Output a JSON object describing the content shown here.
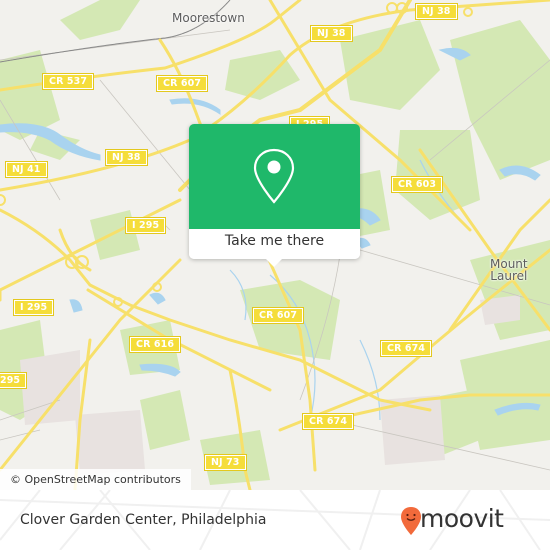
{
  "map": {
    "places": [
      {
        "id": "moorestown",
        "label": "Moorestown"
      },
      {
        "id": "mount-laurel",
        "label": "Mount\nLaurel"
      }
    ],
    "road_labels": [
      {
        "id": "nj38-top",
        "label": "NJ 38"
      },
      {
        "id": "nj38-upper",
        "label": "NJ 38"
      },
      {
        "id": "cr537",
        "label": "CR 537"
      },
      {
        "id": "cr607-top",
        "label": "CR 607"
      },
      {
        "id": "i295-top",
        "label": "I 295"
      },
      {
        "id": "nj38-left",
        "label": "NJ 38"
      },
      {
        "id": "nj41",
        "label": "NJ 41"
      },
      {
        "id": "cr603",
        "label": "CR 603"
      },
      {
        "id": "i295-mid",
        "label": "I 295"
      },
      {
        "id": "i295-left",
        "label": "I 295"
      },
      {
        "id": "cr607-mid",
        "label": "CR 607"
      },
      {
        "id": "cr616",
        "label": "CR 616"
      },
      {
        "id": "cr674-right",
        "label": "CR 674"
      },
      {
        "id": "i295-edge",
        "label": "295"
      },
      {
        "id": "cr674-bottom",
        "label": "CR 674"
      },
      {
        "id": "nj73",
        "label": "NJ 73"
      }
    ],
    "attribution": "© OpenStreetMap contributors",
    "colors": {
      "background": "#f2f1ed",
      "park": "#d4e8b4",
      "water": "#a9d3ef",
      "road": "#f7e06a",
      "minor_road": "#c9c6c0"
    }
  },
  "popup": {
    "icon": "location-pin-icon",
    "button_label": "Take me there",
    "color": "#1fb86a"
  },
  "footer": {
    "place_name": "Clover Garden Center, Philadelphia",
    "brand": "moovit",
    "brand_color": "#f26a3b"
  }
}
